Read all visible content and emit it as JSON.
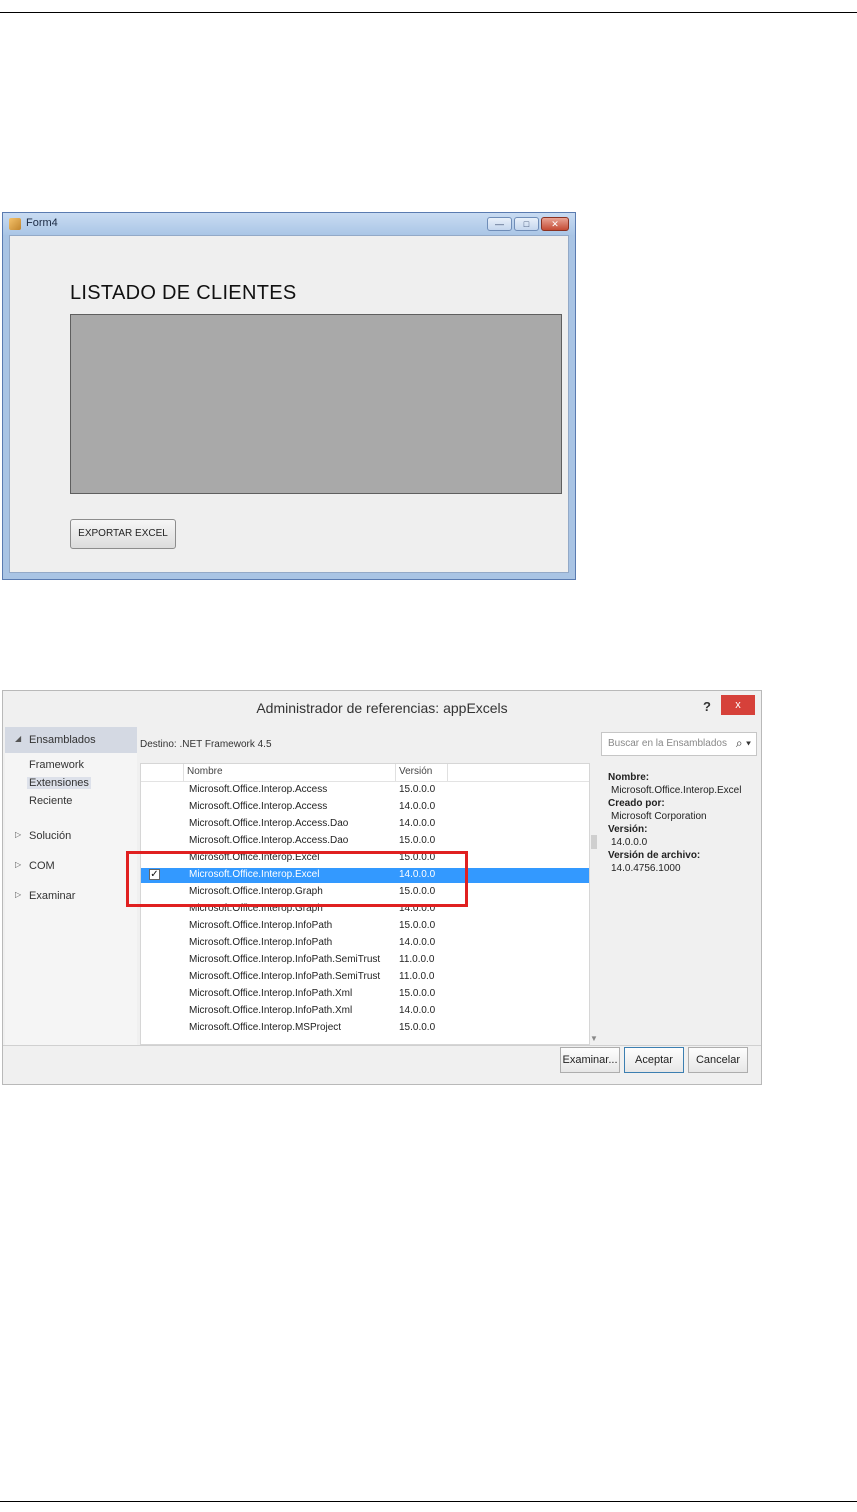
{
  "form4": {
    "title": "Form4",
    "heading": "LISTADO DE CLIENTES",
    "button_label": "EXPORTAR EXCEL",
    "controls": [
      "—",
      "□",
      "✕"
    ]
  },
  "dialog": {
    "title": "Administrador de referencias: appExcels",
    "help": "?",
    "close": "x",
    "left_panel": {
      "ensamblados": "Ensamblados",
      "sub_items": [
        "Framework",
        "Extensiones",
        "Reciente"
      ],
      "sections": [
        "Solución",
        "COM",
        "Examinar"
      ]
    },
    "target": "Destino: .NET Framework 4.5",
    "search_placeholder": "Buscar en la Ensamblados (C",
    "columns": {
      "name": "Nombre",
      "version": "Versión"
    },
    "rows": [
      {
        "name": "Microsoft.Office.Interop.Access",
        "version": "15.0.0.0",
        "checked": false
      },
      {
        "name": "Microsoft.Office.Interop.Access",
        "version": "14.0.0.0",
        "checked": false
      },
      {
        "name": "Microsoft.Office.Interop.Access.Dao",
        "version": "14.0.0.0",
        "checked": false
      },
      {
        "name": "Microsoft.Office.Interop.Access.Dao",
        "version": "15.0.0.0",
        "checked": false
      },
      {
        "name": "Microsoft.Office.Interop.Excel",
        "version": "15.0.0.0",
        "checked": false
      },
      {
        "name": "Microsoft.Office.Interop.Excel",
        "version": "14.0.0.0",
        "checked": true,
        "selected": true
      },
      {
        "name": "Microsoft.Office.Interop.Graph",
        "version": "15.0.0.0",
        "checked": false
      },
      {
        "name": "Microsoft.Office.Interop.Graph",
        "version": "14.0.0.0",
        "checked": false
      },
      {
        "name": "Microsoft.Office.Interop.InfoPath",
        "version": "15.0.0.0",
        "checked": false
      },
      {
        "name": "Microsoft.Office.Interop.InfoPath",
        "version": "14.0.0.0",
        "checked": false
      },
      {
        "name": "Microsoft.Office.Interop.InfoPath.SemiTrust",
        "version": "11.0.0.0",
        "checked": false
      },
      {
        "name": "Microsoft.Office.Interop.InfoPath.SemiTrust",
        "version": "11.0.0.0",
        "checked": false
      },
      {
        "name": "Microsoft.Office.Interop.InfoPath.Xml",
        "version": "15.0.0.0",
        "checked": false
      },
      {
        "name": "Microsoft.Office.Interop.InfoPath.Xml",
        "version": "14.0.0.0",
        "checked": false
      },
      {
        "name": "Microsoft.Office.Interop.MSProject",
        "version": "15.0.0.0",
        "checked": false
      }
    ],
    "details": {
      "name_label": "Nombre:",
      "name_value": "Microsoft.Office.Interop.Excel",
      "creator_label": "Creado por:",
      "creator_value": "Microsoft Corporation",
      "version_label": "Versión:",
      "version_value": "14.0.0.0",
      "file_version_label": "Versión de archivo:",
      "file_version_value": "14.0.4756.1000"
    },
    "buttons": {
      "browse": "Examinar...",
      "ok": "Aceptar",
      "cancel": "Cancelar"
    }
  },
  "colors": {
    "selection": "#3399ff",
    "highlight_box": "#e02020",
    "close_button": "#d6413a"
  }
}
